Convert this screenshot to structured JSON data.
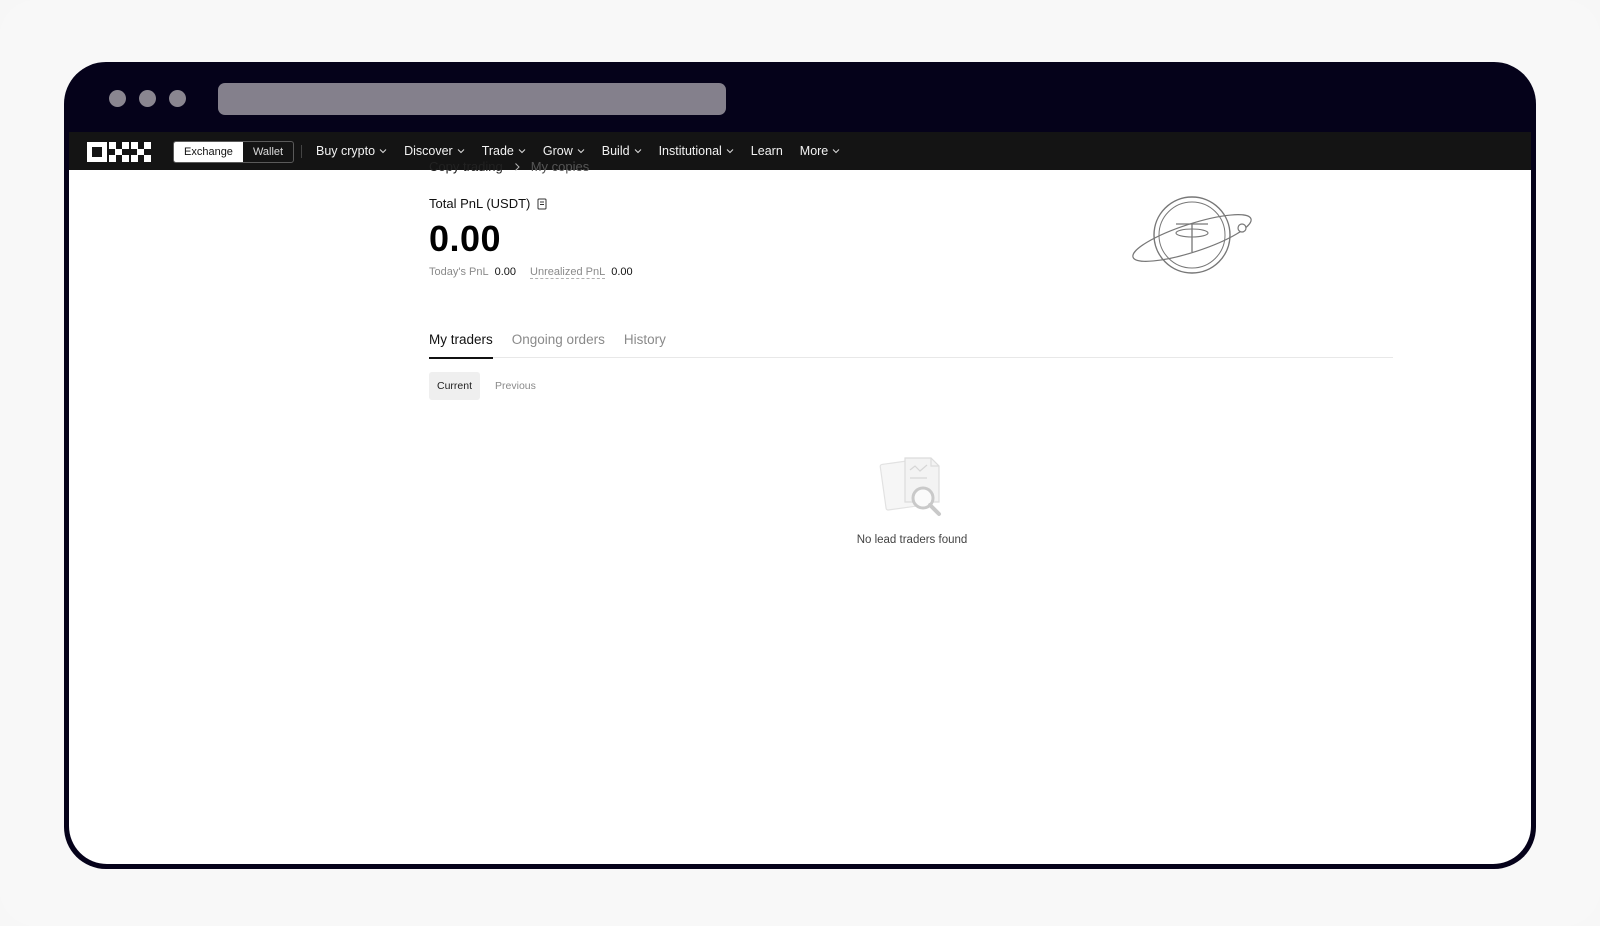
{
  "navbar": {
    "switch": [
      "Exchange",
      "Wallet"
    ],
    "active_switch": "Exchange",
    "menu": [
      {
        "label": "Buy crypto",
        "dropdown": true
      },
      {
        "label": "Discover",
        "dropdown": true
      },
      {
        "label": "Trade",
        "dropdown": true
      },
      {
        "label": "Grow",
        "dropdown": true
      },
      {
        "label": "Build",
        "dropdown": true
      },
      {
        "label": "Institutional",
        "dropdown": true
      },
      {
        "label": "Learn",
        "dropdown": false
      },
      {
        "label": "More",
        "dropdown": true
      }
    ]
  },
  "breadcrumb": {
    "parent": "Copy trading",
    "current": "My copies"
  },
  "pnl": {
    "title": "Total PnL (USDT)",
    "value": "0.00",
    "today_label": "Today's PnL",
    "today_value": "0.00",
    "unrealized_label": "Unrealized PnL",
    "unrealized_value": "0.00"
  },
  "tabs": [
    "My traders",
    "Ongoing orders",
    "History"
  ],
  "active_tab": "My traders",
  "subtabs": [
    "Current",
    "Previous"
  ],
  "active_subtab": "Current",
  "empty_state": {
    "message": "No lead traders found"
  },
  "colors": {
    "browser_frame": "#05021a",
    "navbar": "#141414",
    "text_primary": "#111111",
    "text_muted": "#8a8a8a"
  },
  "icons": {
    "logo": "okx-logo",
    "chevron": "chevron-down-icon",
    "breadcrumb_sep": "chevron-right-icon",
    "pnl_info": "document-icon",
    "hero": "tether-planet-illustration",
    "empty": "search-document-illustration"
  }
}
